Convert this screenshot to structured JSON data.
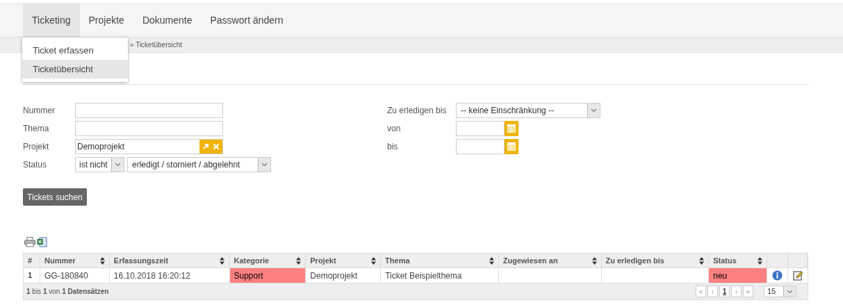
{
  "nav": [
    {
      "label": "Ticketing",
      "selected": true
    },
    {
      "label": "Projekte",
      "selected": false
    },
    {
      "label": "Dokumente",
      "selected": false
    },
    {
      "label": "Passwort ändern",
      "selected": false
    }
  ],
  "dropdown": [
    {
      "label": "Ticket erfassen",
      "selected": false
    },
    {
      "label": "Ticketübersicht",
      "selected": true
    }
  ],
  "breadcrumb": "» Ticketübersicht",
  "form_left": [
    {
      "kind": "text",
      "label": "Nummer"
    },
    {
      "kind": "text",
      "label": "Thema"
    },
    {
      "kind": "lookup",
      "label": "Projekt",
      "value": "Demoprojekt"
    },
    {
      "kind": "status",
      "label": "Status",
      "operator": "ist nicht",
      "value": "erledigt / storniert / abgelehnt"
    }
  ],
  "form_right": [
    {
      "kind": "select",
      "label": "Zu erledigen bis",
      "value": "-- keine Einschränkung --"
    },
    {
      "kind": "date",
      "label": "von"
    },
    {
      "kind": "date",
      "label": "bis"
    }
  ],
  "search_button": "Tickets suchen",
  "table": {
    "columns": [
      {
        "label": "#",
        "sortable": false
      },
      {
        "label": "Nummer",
        "sortable": true
      },
      {
        "label": "Erfassungszeit",
        "sortable": true
      },
      {
        "label": "Kategorie",
        "sortable": true
      },
      {
        "label": "Projekt",
        "sortable": true
      },
      {
        "label": "Thema",
        "sortable": true
      },
      {
        "label": "Zugewiesen an",
        "sortable": true
      },
      {
        "label": "Zu erledigen bis",
        "sortable": true
      },
      {
        "label": "Status",
        "sortable": true
      },
      {
        "sortable": false
      },
      {
        "sortable": false
      }
    ],
    "rows": [
      {
        "cells": [
          {
            "text": "1"
          },
          {
            "text": "GG-180840"
          },
          {
            "text": "16.10.2018 16:20:12"
          },
          {
            "text": "Support",
            "color": "#ff8080"
          },
          {
            "text": "Demoprojekt"
          },
          {
            "text": "Ticket Beispielthema"
          },
          {},
          {},
          {
            "text": "neu",
            "color": "#ff8080"
          }
        ]
      }
    ]
  },
  "footer": "**1** bis **1** von **1 Datensätzen**",
  "pagination": [
    "«",
    "‹",
    "1",
    "›",
    "»"
  ],
  "page_size": "15"
}
